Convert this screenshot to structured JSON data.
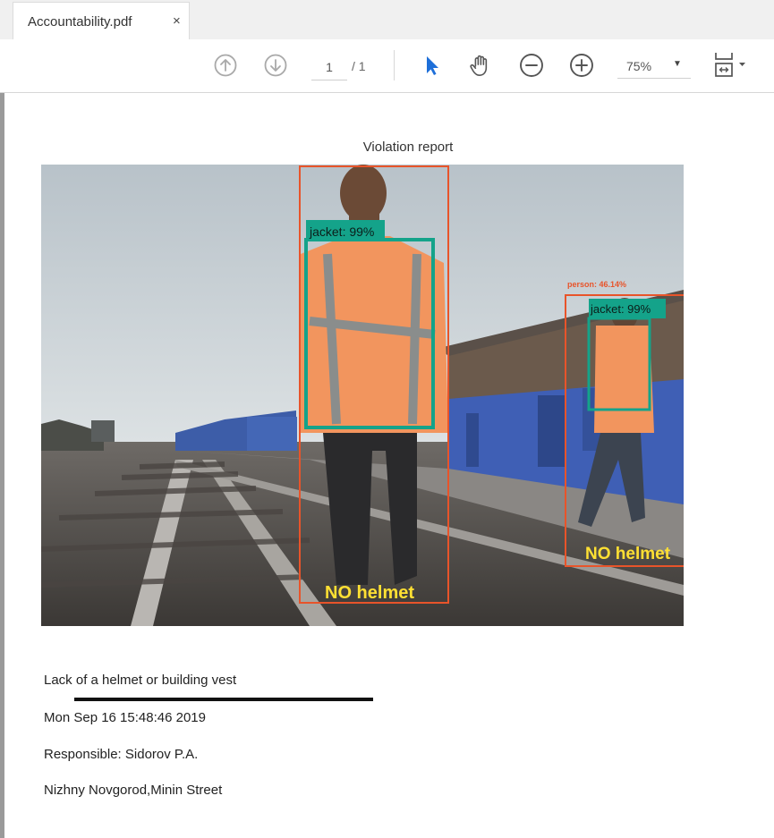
{
  "tab": {
    "title": "Accountability.pdf",
    "close_glyph": "×"
  },
  "toolbar": {
    "prev_page_icon": "arrow-up-circle-icon",
    "next_page_icon": "arrow-down-circle-icon",
    "current_page": "1",
    "total_pages": "/ 1",
    "select_tool_icon": "pointer-arrow-icon",
    "hand_tool_icon": "hand-icon",
    "zoom_out_icon": "minus-circle-icon",
    "zoom_in_icon": "plus-circle-icon",
    "zoom_level": "75%",
    "fit_page_icon": "fit-page-icon",
    "accent_color": "#1e6fd9"
  },
  "document": {
    "title": "Violation report",
    "detections": {
      "worker1_jacket": "jacket: 99%",
      "worker2_person": "person: 46.14%",
      "worker2_jacket": "jacket: 99%",
      "worker1_helmet": "NO helmet",
      "worker2_helmet": "NO helmet"
    },
    "violation_text": "Lack of a helmet or building vest",
    "datetime": "Mon Sep 16 15:48:46 2019",
    "responsible": "Responsible: Sidorov P.A.",
    "location": "Nizhny Novgorod,Minin Street",
    "colors": {
      "person_box": "#e8542a",
      "jacket_box": "#14a38a",
      "helmet_text": "#ffe033"
    }
  }
}
